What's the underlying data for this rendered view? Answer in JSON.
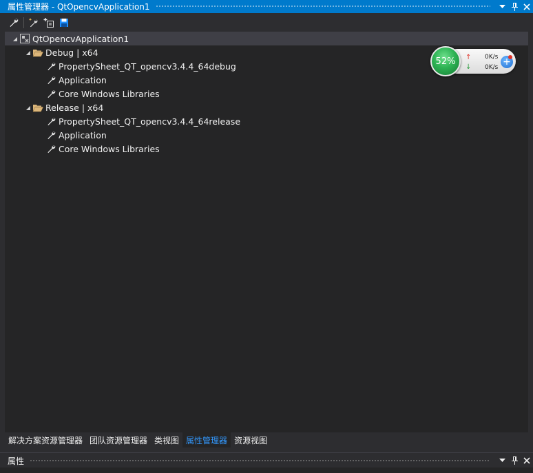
{
  "window": {
    "title": "属性管理器 - QtOpencvApplication1",
    "dropdown_icon": "chevron-down-icon",
    "pin_icon": "pin-icon",
    "close_icon": "close-icon"
  },
  "toolbar": {
    "tools": [
      "properties-wrench-icon",
      "add-new-property-sheet-icon",
      "add-existing-property-sheet-icon",
      "save-icon"
    ]
  },
  "tree": {
    "root": {
      "label": "QtOpencvApplication1",
      "expanded": true,
      "icon": "project-icon"
    },
    "configs": [
      {
        "label": "Debug | x64",
        "expanded": true,
        "icon": "folder-open-icon",
        "items": [
          "PropertySheet_QT_opencv3.4.4_64debug",
          "Application",
          "Core Windows Libraries"
        ]
      },
      {
        "label": "Release | x64",
        "expanded": true,
        "icon": "folder-open-icon",
        "items": [
          "PropertySheet_QT_opencv3.4.4_64release",
          "Application",
          "Core Windows Libraries"
        ]
      }
    ]
  },
  "network_widget": {
    "percent": "52%",
    "upload": "0K/s",
    "download": "0K/s",
    "colors": {
      "ball": "#2eb354",
      "up_arrow": "#e0342a",
      "down_arrow": "#2a9d3d"
    }
  },
  "tabs": [
    {
      "label": "解决方案资源管理器",
      "active": false
    },
    {
      "label": "团队资源管理器",
      "active": false
    },
    {
      "label": "类视图",
      "active": false
    },
    {
      "label": "属性管理器",
      "active": true
    },
    {
      "label": "资源视图",
      "active": false
    }
  ],
  "properties_panel": {
    "title": "属性"
  },
  "colors": {
    "accent": "#007acc",
    "active_tab_text": "#3399ff",
    "background": "#252526"
  }
}
